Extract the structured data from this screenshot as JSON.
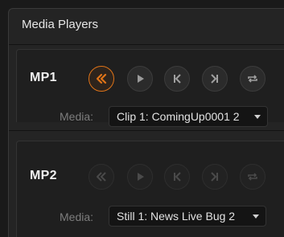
{
  "panel": {
    "title": "Media Players"
  },
  "players": [
    {
      "label": "MP1",
      "media_label": "Media:",
      "media_value": "Clip 1: ComingUp0001 2",
      "controls": {
        "rewind": "rewind-icon",
        "play": "play-icon",
        "prev": "skip-to-start-icon",
        "next": "skip-to-end-icon",
        "loop": "loop-icon"
      },
      "enabled": true
    },
    {
      "label": "MP2",
      "media_label": "Media:",
      "media_value": "Still 1: News Live Bug 2",
      "enabled": false
    }
  ],
  "colors": {
    "accent": "#e07418",
    "background": "#1a1a1a"
  }
}
